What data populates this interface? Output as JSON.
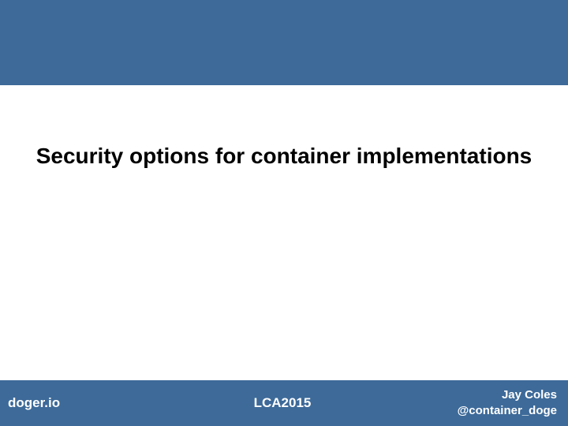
{
  "slide": {
    "title": "Security options for container implementations"
  },
  "footer": {
    "left": "doger.io",
    "center": "LCA2015",
    "right_name": "Jay Coles",
    "right_handle": "@container_doge"
  }
}
